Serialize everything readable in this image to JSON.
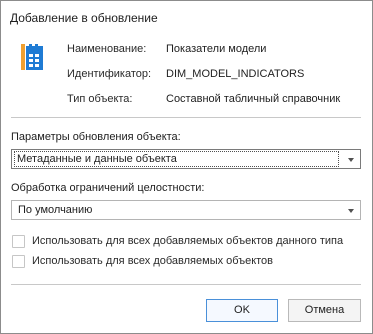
{
  "dialog": {
    "title": "Добавление в обновление"
  },
  "object_info": {
    "icon": "table-dictionary-icon",
    "rows": [
      {
        "label": "Наименование:",
        "value": "Показатели модели"
      },
      {
        "label": "Идентификатор:",
        "value": "DIM_MODEL_INDICATORS"
      },
      {
        "label": "Тип объекта:",
        "value": "Составной табличный справочник"
      }
    ]
  },
  "update_params": {
    "label": "Параметры обновления объекта:",
    "selected": "Метаданные и данные объекта"
  },
  "integrity": {
    "label": "Обработка ограничений целостности:",
    "selected": "По умолчанию"
  },
  "checkboxes": [
    {
      "label": "Использовать для всех добавляемых объектов данного типа",
      "checked": false
    },
    {
      "label": "Использовать для всех добавляемых объектов",
      "checked": false
    }
  ],
  "buttons": {
    "ok": "OK",
    "cancel": "Отмена"
  },
  "colors": {
    "icon_blue": "#1f7bd4",
    "icon_orange": "#f0a030",
    "ok_border": "#4a90d9"
  }
}
